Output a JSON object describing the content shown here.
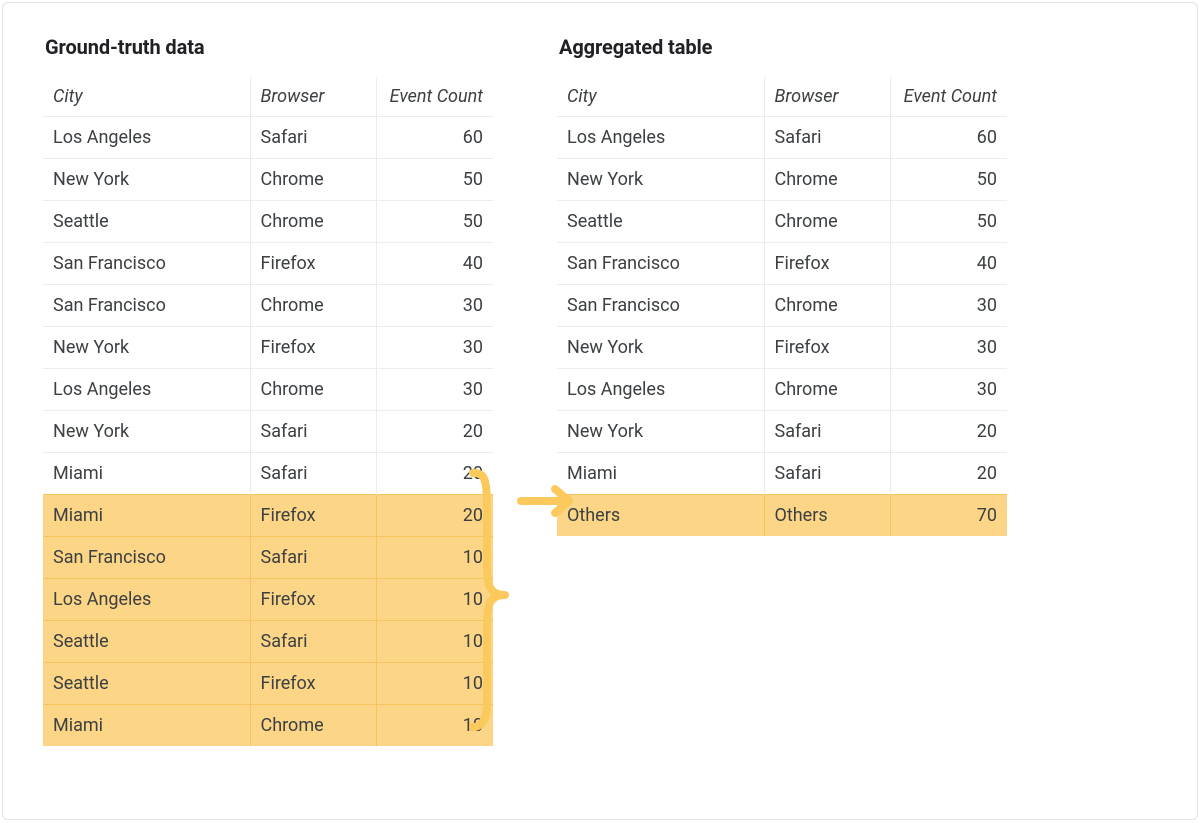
{
  "colors": {
    "highlight": "#fcd586",
    "arrow": "#fbc95c",
    "border": "#e3e3e3"
  },
  "left": {
    "title": "Ground-truth data",
    "headers": {
      "city": "City",
      "browser": "Browser",
      "count": "Event Count"
    },
    "rows": [
      {
        "city": "Los Angeles",
        "browser": "Safari",
        "count": 60,
        "hl": false
      },
      {
        "city": "New York",
        "browser": "Chrome",
        "count": 50,
        "hl": false
      },
      {
        "city": "Seattle",
        "browser": "Chrome",
        "count": 50,
        "hl": false
      },
      {
        "city": "San Francisco",
        "browser": "Firefox",
        "count": 40,
        "hl": false
      },
      {
        "city": "San Francisco",
        "browser": "Chrome",
        "count": 30,
        "hl": false
      },
      {
        "city": "New York",
        "browser": "Firefox",
        "count": 30,
        "hl": false
      },
      {
        "city": "Los Angeles",
        "browser": "Chrome",
        "count": 30,
        "hl": false
      },
      {
        "city": "New York",
        "browser": "Safari",
        "count": 20,
        "hl": false
      },
      {
        "city": "Miami",
        "browser": "Safari",
        "count": 20,
        "hl": false
      },
      {
        "city": "Miami",
        "browser": "Firefox",
        "count": 20,
        "hl": true
      },
      {
        "city": "San Francisco",
        "browser": "Safari",
        "count": 10,
        "hl": true
      },
      {
        "city": "Los Angeles",
        "browser": "Firefox",
        "count": 10,
        "hl": true
      },
      {
        "city": "Seattle",
        "browser": "Safari",
        "count": 10,
        "hl": true
      },
      {
        "city": "Seattle",
        "browser": "Firefox",
        "count": 10,
        "hl": true
      },
      {
        "city": "Miami",
        "browser": "Chrome",
        "count": 10,
        "hl": true
      }
    ]
  },
  "right": {
    "title": "Aggregated table",
    "headers": {
      "city": "City",
      "browser": "Browser",
      "count": "Event Count"
    },
    "rows": [
      {
        "city": "Los Angeles",
        "browser": "Safari",
        "count": 60,
        "hl": false
      },
      {
        "city": "New York",
        "browser": "Chrome",
        "count": 50,
        "hl": false
      },
      {
        "city": "Seattle",
        "browser": "Chrome",
        "count": 50,
        "hl": false
      },
      {
        "city": "San Francisco",
        "browser": "Firefox",
        "count": 40,
        "hl": false
      },
      {
        "city": "San Francisco",
        "browser": "Chrome",
        "count": 30,
        "hl": false
      },
      {
        "city": "New York",
        "browser": "Firefox",
        "count": 30,
        "hl": false
      },
      {
        "city": "Los Angeles",
        "browser": "Chrome",
        "count": 30,
        "hl": false
      },
      {
        "city": "New York",
        "browser": "Safari",
        "count": 20,
        "hl": false
      },
      {
        "city": "Miami",
        "browser": "Safari",
        "count": 20,
        "hl": false
      },
      {
        "city": "Others",
        "browser": "Others",
        "count": 70,
        "hl": true
      }
    ]
  }
}
